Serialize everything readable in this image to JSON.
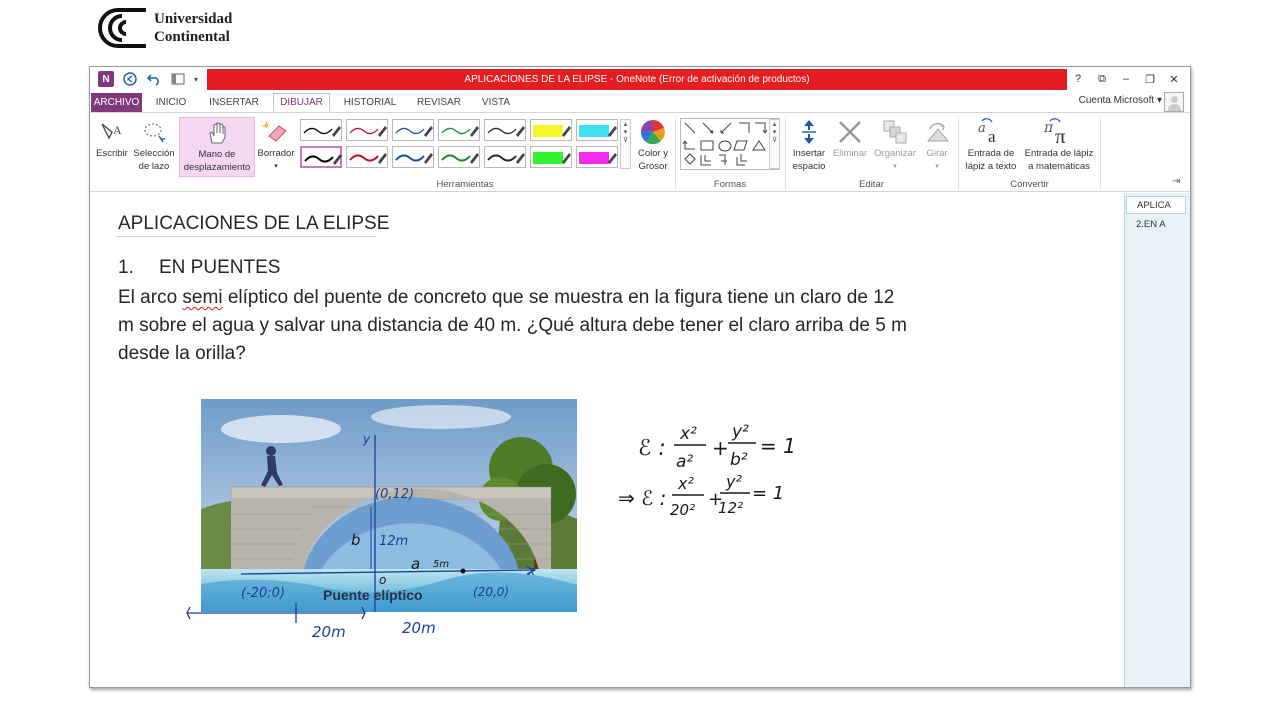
{
  "brand": {
    "line1": "Universidad",
    "line2": "Continental"
  },
  "window": {
    "title": "APLICACIONES DE LA ELIPSE -  OneNote (Error de activación de productos)",
    "controls": [
      "?",
      "⧉",
      "–",
      "❐",
      "✕"
    ]
  },
  "tabs": [
    {
      "label": "ARCHIVO"
    },
    {
      "label": "INICIO"
    },
    {
      "label": "INSERTAR"
    },
    {
      "label": "DIBUJAR"
    },
    {
      "label": "HISTORIAL"
    },
    {
      "label": "REVISAR"
    },
    {
      "label": "VISTA"
    }
  ],
  "account": {
    "label": "Cuenta Microsoft"
  },
  "ribbon": {
    "tools": [
      {
        "label": "Escribir",
        "icon": "pen-text-icon"
      },
      {
        "label": "Selección de lazo",
        "icon": "lasso-icon"
      },
      {
        "label": "Mano de desplazamiento",
        "icon": "hand-icon"
      },
      {
        "label": "Borrador",
        "icon": "eraser-icon"
      }
    ],
    "color_button": "Color y Grosor",
    "insert_space": "Insertar espacio",
    "edit": [
      {
        "label": "Eliminar",
        "icon": "delete-x-icon"
      },
      {
        "label": "Organizar",
        "icon": "arrange-icon"
      },
      {
        "label": "Girar",
        "icon": "rotate-icon"
      }
    ],
    "convert": [
      {
        "label": "Entrada de lápiz a texto",
        "icon": "ink-to-text-icon"
      },
      {
        "label": "Entrada de lápiz a matemáticas",
        "icon": "ink-to-math-icon"
      }
    ],
    "groups": {
      "herramientas": "Herramientas",
      "formas": "Formas",
      "editar": "Editar",
      "convertir": "Convertir"
    },
    "pen_colors": [
      "#000000",
      "#c8102e",
      "#1f4e9a",
      "#1a8a3a",
      "#2b2b2b",
      "#f5f52a",
      "#3fe0f0",
      "#000000",
      "#c8102e",
      "#1f4e9a",
      "#1a8a3a",
      "#2b2b2b",
      "#31f531",
      "#f52af0"
    ]
  },
  "note": {
    "title": "APLICACIONES DE LA ELIPSE",
    "section_number": "1.",
    "section_title": "EN PUENTES",
    "problem_prefix": "El arco ",
    "problem_misspelled": "semi",
    "problem_rest": " elíptico del puente de concreto que se muestra en la figura tiene un claro de 12 m sobre el agua y salvar una distancia de 40 m. ¿Qué altura debe tener el claro arriba de 5 m desde la orilla?"
  },
  "figure": {
    "caption": "Puente elíptico",
    "annotations": {
      "top_point": "(0,12)",
      "b_label": "b",
      "height": "12m",
      "a_label": "a",
      "five_m": "5m",
      "origin": "o",
      "left_point": "(-20;0)",
      "right_point": "(20,0)",
      "left_span": "20m",
      "right_span": "20m",
      "x_axis": "x",
      "y_axis": "y"
    }
  },
  "handwritten_equations": {
    "eq1": "ℰ : x²/a² + y²/b² = 1",
    "eq2": "⇒ ℰ : x²/20² + y²/12² = 1"
  },
  "pages": [
    {
      "label": "APLICA"
    },
    {
      "label": "2.EN A"
    }
  ]
}
